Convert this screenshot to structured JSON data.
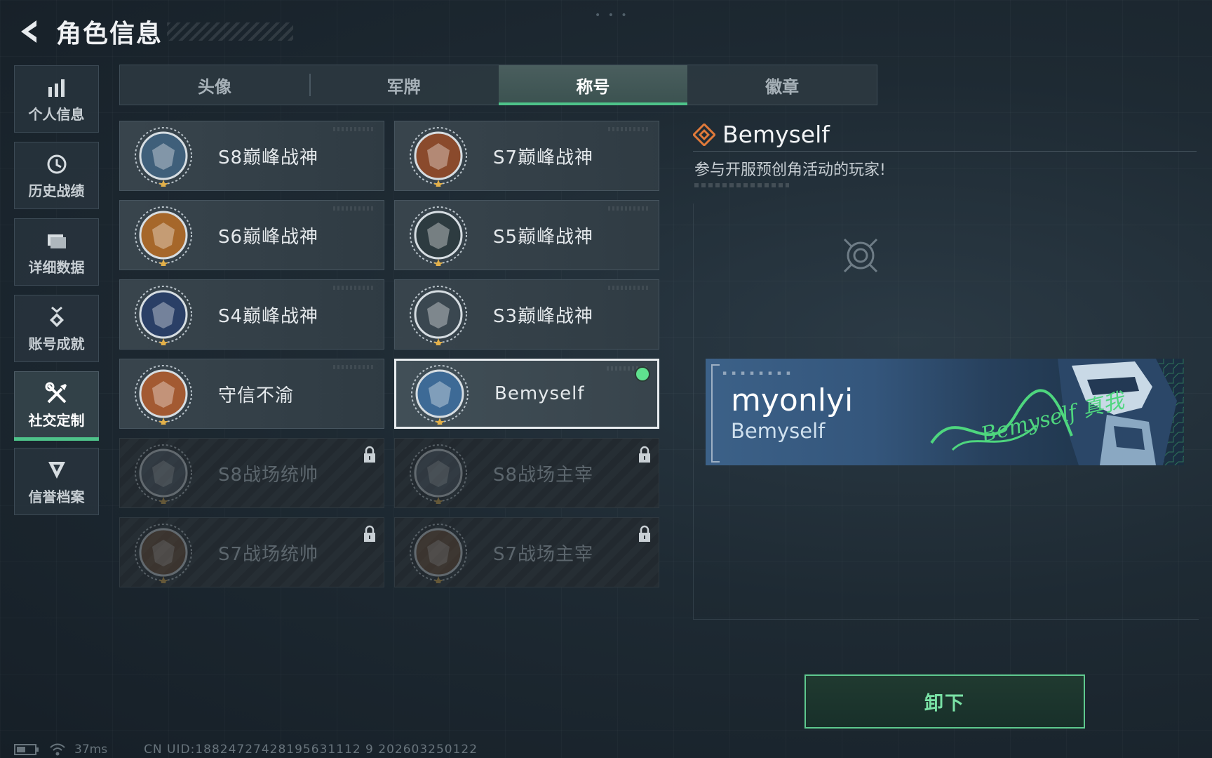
{
  "header": {
    "title": "角色信息"
  },
  "sidebar": {
    "items": [
      {
        "label": "个人信息",
        "icon": "bar-chart-icon"
      },
      {
        "label": "历史战绩",
        "icon": "history-clock-icon"
      },
      {
        "label": "详细数据",
        "icon": "folder-icon"
      },
      {
        "label": "账号成就",
        "icon": "medal-icon"
      },
      {
        "label": "社交定制",
        "icon": "tools-icon",
        "active": true
      },
      {
        "label": "信誉档案",
        "icon": "shield-icon"
      }
    ]
  },
  "tabs": [
    {
      "label": "头像"
    },
    {
      "label": "军牌"
    },
    {
      "label": "称号",
      "active": true
    },
    {
      "label": "徽章"
    }
  ],
  "titles": [
    {
      "name": "S8巅峰战神",
      "badge": "s8-emblem-icon",
      "color": "#3f5f7a",
      "state": "owned"
    },
    {
      "name": "S7巅峰战神",
      "badge": "s7-rifle-emblem-icon",
      "color": "#8a4a2c",
      "state": "owned"
    },
    {
      "name": "S6巅峰战神",
      "badge": "s6-shield-emblem-icon",
      "color": "#a6672a",
      "state": "owned"
    },
    {
      "name": "S5巅峰战神",
      "badge": "s5-skull-emblem-icon",
      "color": "#2d3b40",
      "state": "owned"
    },
    {
      "name": "S4巅峰战神",
      "badge": "s4-helmet-emblem-icon",
      "color": "#2a3f66",
      "state": "owned"
    },
    {
      "name": "S3巅峰战神",
      "badge": "s3-globe-emblem-icon",
      "color": "#3a4750",
      "state": "owned"
    },
    {
      "name": "守信不渝",
      "badge": "scales-emblem-icon",
      "color": "#a35a32",
      "state": "owned"
    },
    {
      "name": "Bemyself",
      "badge": "bemyself-soldier-emblem-icon",
      "color": "#3d6a96",
      "state": "equipped"
    },
    {
      "name": "S8战场统帅",
      "badge": "tank-emblem-icon",
      "color": "#4a5560",
      "state": "locked"
    },
    {
      "name": "S8战场主宰",
      "badge": "building-emblem-icon",
      "color": "#4a5560",
      "state": "locked"
    },
    {
      "name": "S7战场统帅",
      "badge": "vehicle-emblem-icon",
      "color": "#6a4a30",
      "state": "locked"
    },
    {
      "name": "S7战场主宰",
      "badge": "soldier-emblem-icon",
      "color": "#6a4a30",
      "state": "locked"
    }
  ],
  "detail": {
    "title": "Bemyself",
    "description": "参与开服预创角活动的玩家!",
    "title_icon_color": "#e07a3a"
  },
  "namecard": {
    "player_name": "myonlyi",
    "title": "Bemyself",
    "signature": "Bemyself 真我"
  },
  "actions": {
    "unequip_label": "卸下"
  },
  "status": {
    "ping": "37ms",
    "uid": "CN UID:18824727428195631112 9 202603250122"
  },
  "colors": {
    "accent": "#4ec38a",
    "equipped_dot": "#5fe08e"
  }
}
